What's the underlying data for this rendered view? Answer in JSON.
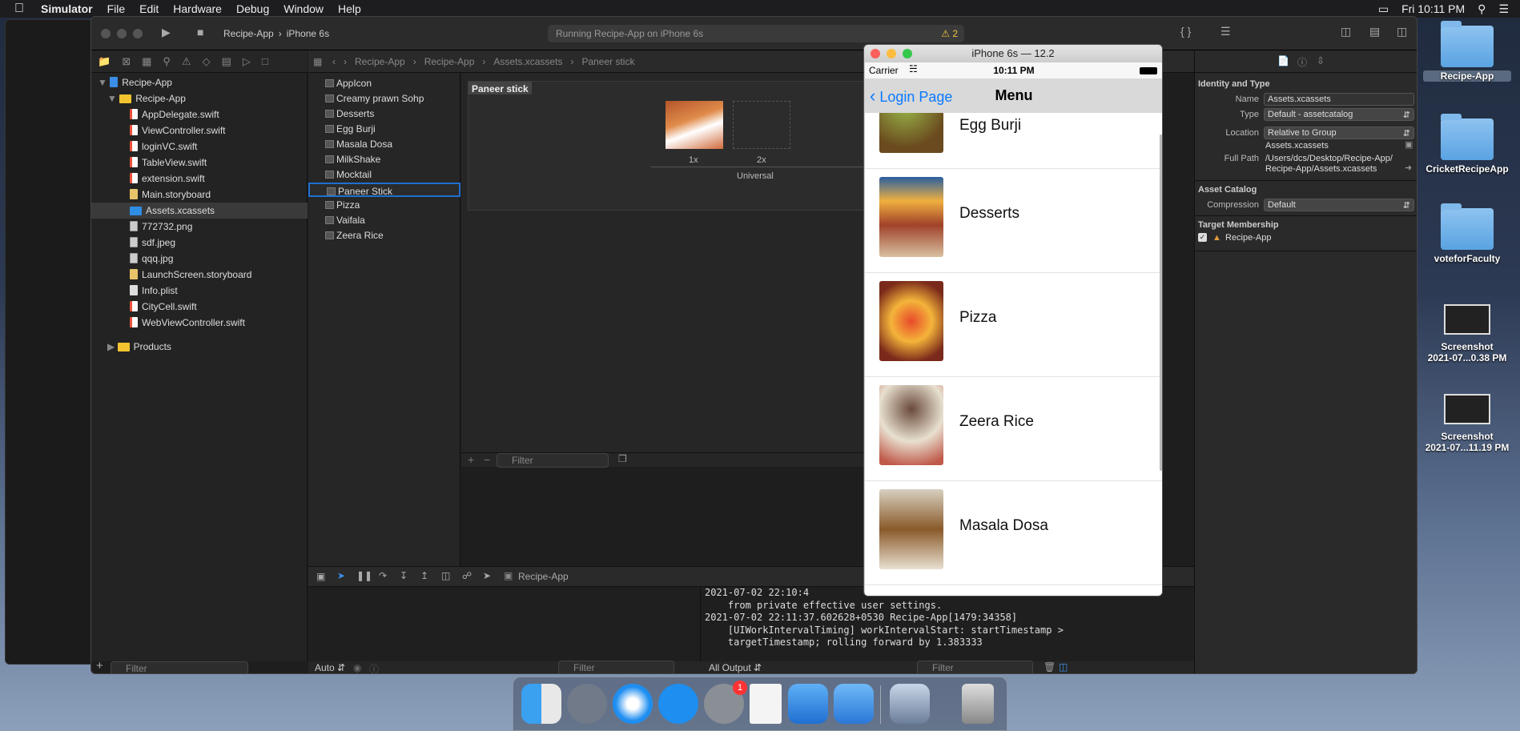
{
  "menubar": {
    "app_name": "Simulator",
    "items": [
      "File",
      "Edit",
      "Hardware",
      "Debug",
      "Window",
      "Help"
    ],
    "clock": "Fri 10:11 PM"
  },
  "xcode": {
    "scheme": "Recipe-App",
    "device": "iPhone 6s",
    "activity": "Running Recipe-App on iPhone 6s",
    "warnings": "2",
    "jumpbar": [
      "Recipe-App",
      "Recipe-App",
      "Assets.xcassets",
      "Paneer stick"
    ],
    "navigator": {
      "project": "Recipe-App",
      "group": "Recipe-App",
      "files": [
        {
          "name": "AppDelegate.swift",
          "kind": "swift"
        },
        {
          "name": "ViewController.swift",
          "kind": "swift"
        },
        {
          "name": "loginVC.swift",
          "kind": "swift"
        },
        {
          "name": "TableView.swift",
          "kind": "swift"
        },
        {
          "name": "extension.swift",
          "kind": "swift"
        },
        {
          "name": "Main.storyboard",
          "kind": "storyboard"
        },
        {
          "name": "Assets.xcassets",
          "kind": "assets"
        },
        {
          "name": "772732.png",
          "kind": "image"
        },
        {
          "name": "sdf.jpeg",
          "kind": "image"
        },
        {
          "name": "qqq.jpg",
          "kind": "image"
        },
        {
          "name": "LaunchScreen.storyboard",
          "kind": "storyboard"
        },
        {
          "name": "Info.plist",
          "kind": "plist"
        },
        {
          "name": "CityCell.swift",
          "kind": "swift"
        },
        {
          "name": "WebViewController.swift",
          "kind": "swift"
        }
      ],
      "products": "Products",
      "filter_placeholder": "Filter"
    },
    "assets": {
      "items": [
        "AppIcon",
        "Creamy prawn Sohp",
        "Desserts",
        "Egg Burji",
        "Masala Dosa",
        "MilkShake",
        "Mocktail",
        "Paneer Stick",
        "Pizza",
        "Vaifala",
        "Zeera Rice"
      ],
      "selected": "Paneer Stick",
      "filter_placeholder": "Filter"
    },
    "editor": {
      "set_title": "Paneer stick",
      "slot_1x": "1x",
      "slot_2x": "2x",
      "universal": "Universal"
    },
    "debug": {
      "target": "Recipe-App",
      "auto_label": "Auto",
      "output_label": "All Output",
      "filter_placeholder": "Filter",
      "console_lines": [
        "2021-07-02 22:10:4",
        "    from private effective user settings.",
        "2021-07-02 22:11:37.602628+0530 Recipe-App[1479:34358]",
        "    [UIWorkIntervalTiming] workIntervalStart: startTimestamp >",
        "    targetTimestamp; rolling forward by 1.383333"
      ]
    },
    "inspector": {
      "section_identity": "Identity and Type",
      "name_label": "Name",
      "name_value": "Assets.xcassets",
      "type_label": "Type",
      "type_value": "Default - assetcatalog",
      "location_label": "Location",
      "location_value": "Relative to Group",
      "location_file": "Assets.xcassets",
      "fullpath_label": "Full Path",
      "fullpath_line1": "/Users/dcs/Desktop/Recipe-App/",
      "fullpath_line2": "Recipe-App/Assets.xcassets",
      "section_catalog": "Asset Catalog",
      "compression_label": "Compression",
      "compression_value": "Default",
      "section_target": "Target Membership",
      "target_name": "Recipe-App"
    }
  },
  "simulator": {
    "title": "iPhone 6s — 12.2",
    "carrier": "Carrier",
    "time": "10:11 PM",
    "back_label": "Login Page",
    "nav_title": "Menu",
    "cells": [
      "Egg Burji",
      "Desserts",
      "Pizza",
      "Zeera Rice",
      "Masala Dosa"
    ]
  },
  "desktop": {
    "icons": [
      {
        "label": "Recipe-App"
      },
      {
        "label": "CricketRecipeApp"
      },
      {
        "label": "voteforFaculty"
      },
      {
        "label": "Screenshot",
        "sub": "2021-07...0.38 PM"
      },
      {
        "label": "Screenshot",
        "sub": "2021-07...11.19 PM"
      }
    ]
  },
  "dock": {
    "badge": "1"
  }
}
